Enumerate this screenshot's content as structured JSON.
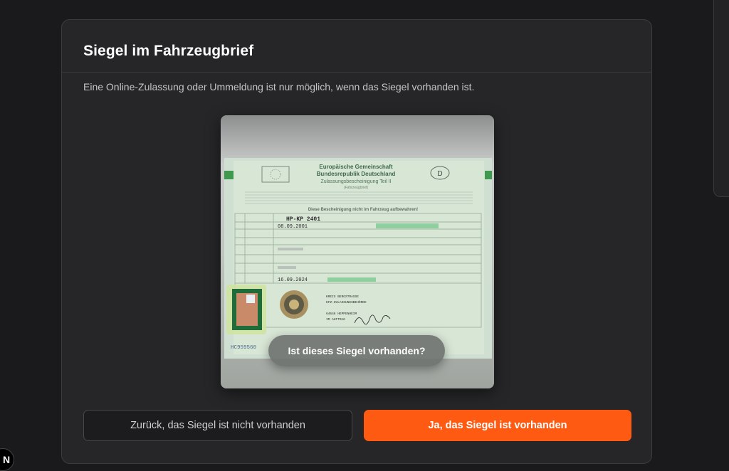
{
  "dialog": {
    "title": "Siegel im Fahrzeugbrief",
    "subtitle": "Eine Online-Zulassung oder Ummeldung ist nur möglich, wenn das Siegel vorhanden ist."
  },
  "preview": {
    "doc_header_line1": "Europäische Gemeinschaft",
    "doc_header_line2": "Bundesrepublik Deutschland",
    "doc_header_line3": "Zulassungsbescheinigung Teil II",
    "doc_header_line4": "(Fahrzeugbrief)",
    "country_code": "D",
    "doc_banner": "Diese Bescheinigung nicht im Fahrzeug aufbewahren!",
    "plate": "HP-KP 2401",
    "date_first": "08.09.2001",
    "date_issue": "16.09.2024",
    "authority_line1": "KREIS BERGSTRASSE",
    "authority_line2": "KFZ-ZULASSUNGSBEHÖRDE",
    "authority_line3": "64646 HEPPENHEIM",
    "authority_line4": "IM AUFTRAG",
    "serial": "HC959560",
    "question": "Ist dieses Siegel vorhanden?"
  },
  "actions": {
    "back_label": "Zurück, das Siegel ist nicht vorhanden",
    "confirm_label": "Ja, das Siegel ist vorhanden"
  },
  "corner_logo": "N",
  "colors": {
    "accent": "#ff5a12",
    "card_bg": "#262628",
    "page_bg": "#1a1a1c"
  }
}
